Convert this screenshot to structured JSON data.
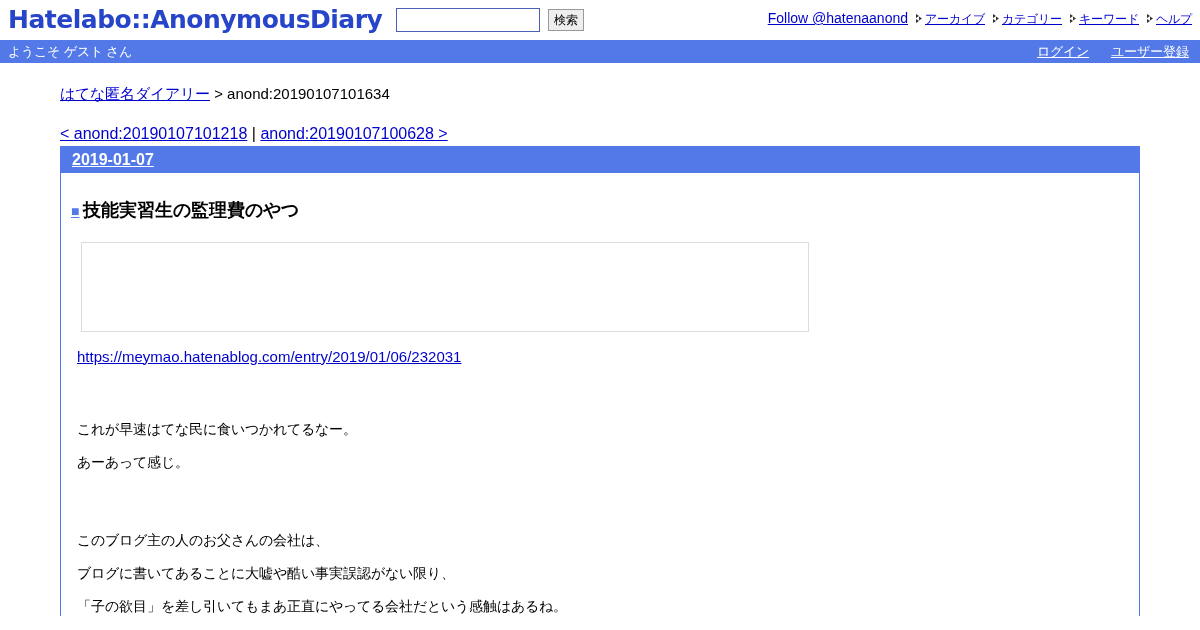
{
  "header": {
    "logo": "Hatelabo::AnonymousDiary",
    "search": {
      "button": "検索"
    },
    "follow": "Follow @hatenaanond",
    "nav": [
      "アーカイブ",
      "カテゴリー",
      "キーワード",
      "ヘルプ"
    ]
  },
  "bar": {
    "welcome": "ようこそ ゲスト さん",
    "links": [
      "ログイン",
      "ユーザー登録"
    ]
  },
  "breadcrumb": {
    "home": "はてな匿名ダイアリー",
    "current": "> anond:20190107101634"
  },
  "pager": {
    "prev": "< anond:20190107101218",
    "separator": "|",
    "next": "anond:20190107100628 >"
  },
  "day": {
    "date": "2019-01-07",
    "section_mark": "■",
    "title": "技能実習生の監理費のやつ",
    "link": "https://meymao.hatenablog.com/entry/2019/01/06/232031",
    "paragraphs": [
      {
        "kind": "blank"
      },
      {
        "text": "これが早速はてな民に食いつかれてるなー。",
        "kind": "text"
      },
      {
        "text": "あーあって感じ。",
        "kind": "text"
      },
      {
        "kind": "blank"
      },
      {
        "text": "このブログ主の人のお父さんの会社は、",
        "kind": "text"
      },
      {
        "text": "ブログに書いてあることに大嘘や酷い事実誤認がない限り、",
        "kind": "text"
      },
      {
        "text": "「子の欲目」を差し引いてもまあ正直にやってる会社だという感触はあるね。",
        "kind": "text"
      }
    ]
  }
}
